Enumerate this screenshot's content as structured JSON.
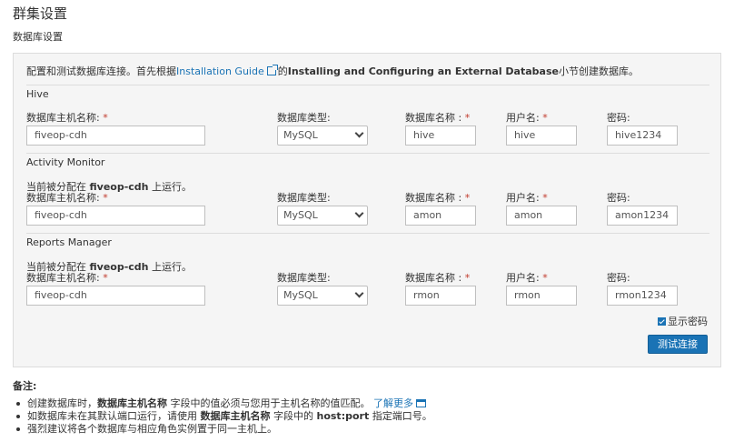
{
  "page": {
    "title": "群集设置",
    "subtitle": "数据库设置"
  },
  "intro": {
    "before": "配置和测试数据库连接。首先根据",
    "link": "Installation Guide",
    "mid": "的",
    "bold": "Installing and Configuring an External Database",
    "after": "小节创建数据库。"
  },
  "labels": {
    "host": "数据库主机名称:",
    "type": "数据库类型:",
    "dbname": "数据库名称 :",
    "user": "用户名:",
    "password": "密码:",
    "required_mark": "*"
  },
  "assign": {
    "prefix": "当前被分配在 ",
    "host": "fiveop-cdh",
    "suffix": " 上运行。"
  },
  "sections": [
    {
      "title": "Hive",
      "host": "fiveop-cdh",
      "type": "MySQL",
      "dbname": "hive",
      "user": "hive",
      "password": "hive1234"
    },
    {
      "title": "Activity Monitor",
      "host": "fiveop-cdh",
      "type": "MySQL",
      "dbname": "amon",
      "user": "amon",
      "password": "amon1234"
    },
    {
      "title": "Reports Manager",
      "host": "fiveop-cdh",
      "type": "MySQL",
      "dbname": "rmon",
      "user": "rmon",
      "password": "rmon1234"
    }
  ],
  "show_password": {
    "label": "显示密码",
    "checked": true
  },
  "test_button": "测试连接",
  "notes": {
    "title": "备注:",
    "n1_a": "创建数据库时，",
    "n1_b": "数据库主机名称",
    "n1_c": " 字段中的值必须与您用于主机名称的值匹配。",
    "n1_link": "了解更多",
    "n2_a": "如数据库未在其默认端口运行，请使用 ",
    "n2_b": "数据库主机名称",
    "n2_c": " 字段中的 ",
    "n2_d": "host:port",
    "n2_e": " 指定端口号。",
    "n3": "强烈建议将各个数据库与相应角色实例置于同一主机上。"
  },
  "colors": {
    "accent": "#1a73b5",
    "required": "#c0392b",
    "panel_bg": "#f5f5f5"
  }
}
